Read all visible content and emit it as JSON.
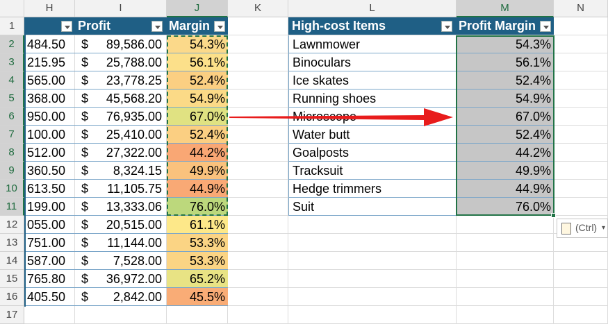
{
  "columns": [
    "H",
    "I",
    "J",
    "K",
    "L",
    "M",
    "N"
  ],
  "rows": [
    "1",
    "2",
    "3",
    "4",
    "5",
    "6",
    "7",
    "8",
    "9",
    "10",
    "11",
    "12",
    "13",
    "14",
    "15",
    "16",
    "17"
  ],
  "left_table": {
    "headers": {
      "profit": "Profit",
      "margin": "Margin"
    },
    "currency": "$",
    "rows": [
      {
        "h": "484.50",
        "profit": "89,586.00",
        "margin": "54.3%",
        "color": "#fbd98a"
      },
      {
        "h": "215.95",
        "profit": "25,788.00",
        "margin": "56.1%",
        "color": "#fce08a"
      },
      {
        "h": "565.00",
        "profit": "23,778.25",
        "margin": "52.4%",
        "color": "#fbcf82"
      },
      {
        "h": "368.00",
        "profit": "45,568.20",
        "margin": "54.9%",
        "color": "#fbda87"
      },
      {
        "h": "950.00",
        "profit": "76,935.00",
        "margin": "67.0%",
        "color": "#e0e282"
      },
      {
        "h": "100.00",
        "profit": "25,410.00",
        "margin": "52.4%",
        "color": "#fbcf82"
      },
      {
        "h": "512.00",
        "profit": "27,322.00",
        "margin": "44.2%",
        "color": "#f9a774"
      },
      {
        "h": "360.50",
        "profit": "8,324.15",
        "margin": "49.9%",
        "color": "#fac27d"
      },
      {
        "h": "613.50",
        "profit": "11,105.75",
        "margin": "44.9%",
        "color": "#f9a975"
      },
      {
        "h": "199.00",
        "profit": "13,333.06",
        "margin": "76.0%",
        "color": "#bcd87c"
      },
      {
        "h": "055.00",
        "profit": "20,515.00",
        "margin": "61.1%",
        "color": "#fde889"
      },
      {
        "h": "751.00",
        "profit": "11,144.00",
        "margin": "53.3%",
        "color": "#fbd484"
      },
      {
        "h": "587.00",
        "profit": "7,528.00",
        "margin": "53.3%",
        "color": "#fbd484"
      },
      {
        "h": "765.80",
        "profit": "36,972.00",
        "margin": "65.2%",
        "color": "#e8e384"
      },
      {
        "h": "405.50",
        "profit": "2,842.00",
        "margin": "45.5%",
        "color": "#f9ac76"
      }
    ]
  },
  "right_table": {
    "headers": {
      "items": "High-cost Items",
      "margin": "Profit Margin"
    },
    "rows": [
      {
        "item": "Lawnmower",
        "margin": "54.3%"
      },
      {
        "item": "Binoculars",
        "margin": "56.1%"
      },
      {
        "item": "Ice skates",
        "margin": "52.4%"
      },
      {
        "item": "Running shoes",
        "margin": "54.9%"
      },
      {
        "item": "Microscope",
        "margin": "67.0%"
      },
      {
        "item": "Water butt",
        "margin": "52.4%"
      },
      {
        "item": "Goalposts",
        "margin": "44.2%"
      },
      {
        "item": "Tracksuit",
        "margin": "49.9%"
      },
      {
        "item": "Hedge trimmers",
        "margin": "44.9%"
      },
      {
        "item": "Suit",
        "margin": "76.0%"
      }
    ]
  },
  "paste_options": {
    "label": "(Ctrl)"
  },
  "colors": {
    "header_blue": "#1f5f85",
    "selection_green": "#217346",
    "arrow_red": "#e81c1c",
    "selected_fill": "#c6c6c6"
  }
}
